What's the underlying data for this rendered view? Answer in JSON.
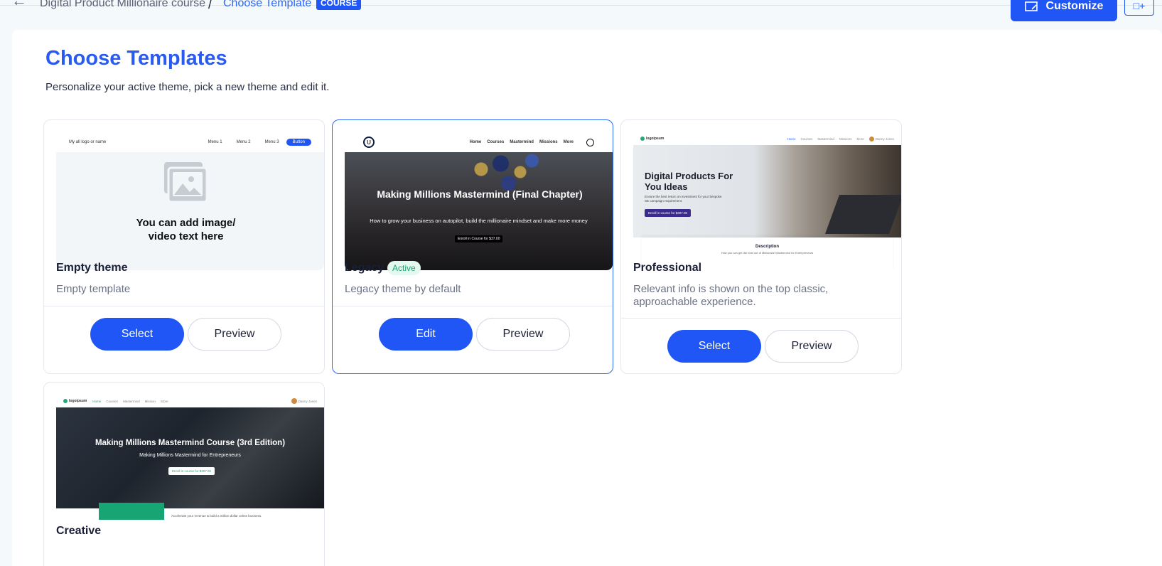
{
  "header": {
    "breadcrumb_course": "Digital Product Millionaire course",
    "breadcrumb_separator": "/",
    "breadcrumb_current": "Choose Template",
    "badge": "COURSE",
    "customize_label": "Customize",
    "add_block_label": "□+"
  },
  "page": {
    "title": "Choose Templates",
    "subtitle": "Personalize your active theme, pick a new theme and edit it."
  },
  "cards": [
    {
      "name": "Empty theme",
      "description": "Empty template",
      "primary_label": "Select",
      "secondary_label": "Preview",
      "thumb": {
        "logo": "My all logo or name",
        "menu": [
          "Menu 1",
          "Menu 2",
          "Menu 3"
        ],
        "cta": "Button",
        "placeholder": "You can add image/ video text here"
      }
    },
    {
      "name": "Legacy",
      "status": "Active",
      "description": "Legacy theme by default",
      "primary_label": "Edit",
      "secondary_label": "Preview",
      "thumb": {
        "logo": "U",
        "menu": [
          "Home",
          "Courses",
          "Mastermind",
          "Missions",
          "More"
        ],
        "hero_title": "Making Millions Mastermind (Final Chapter)",
        "hero_sub": "How to grow your business on autopilot, build the millionaire mindset and make more money",
        "cta": "Enroll in Course for $37.00"
      }
    },
    {
      "name": "Professional",
      "description": "Relevant info is shown on the top classic, approachable experience.",
      "primary_label": "Select",
      "secondary_label": "Preview",
      "thumb": {
        "logo": "logoipsum",
        "menu": [
          "Home",
          "Courses",
          "Mastermind",
          "Missions",
          "More"
        ],
        "user": "Danny Jones",
        "hero_title": "Digital Products For You Ideas",
        "hero_sub": "Ensure the best return on investment for your bespoke SE campaign requirement.",
        "cta": "Enroll in course for $307.00",
        "section_title": "Description",
        "section_text": "How you can get the best out of Millionaire Mastermind for Entrepreneurs"
      }
    },
    {
      "name": "Creative",
      "thumb": {
        "logo": "logoipsum",
        "menu": [
          "Home",
          "Courses",
          "Mastermind",
          "Mission",
          "Store"
        ],
        "user": "Danny Jones",
        "hero_title": "Making Millions Mastermind Course (3rd Edition)",
        "hero_sub": "Making Millions Mastermind for Entrepreneurs",
        "cta": "Enroll in course for $307.00",
        "footer_text": "Accelerate your revenue & build a million dollar online business."
      }
    }
  ],
  "colors": {
    "accent": "#1f56f5",
    "title": "#2a5bf0",
    "active_badge": "#17a673"
  }
}
